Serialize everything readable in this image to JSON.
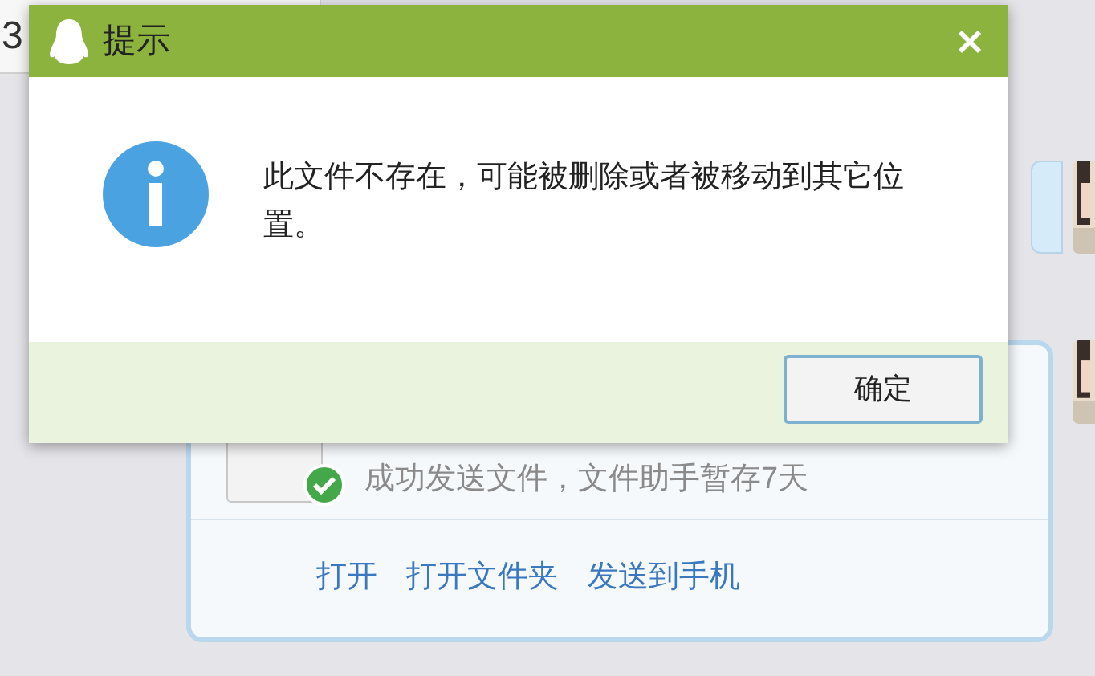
{
  "background": {
    "tab_fragment": "3",
    "file_card": {
      "status": "成功发送文件，文件助手暂存7天",
      "actions": [
        "打开",
        "打开文件夹",
        "发送到手机"
      ]
    }
  },
  "dialog": {
    "title": "提示",
    "message": "此文件不存在，可能被删除或者被移动到其它位置。",
    "buttons": [
      "确定"
    ]
  }
}
